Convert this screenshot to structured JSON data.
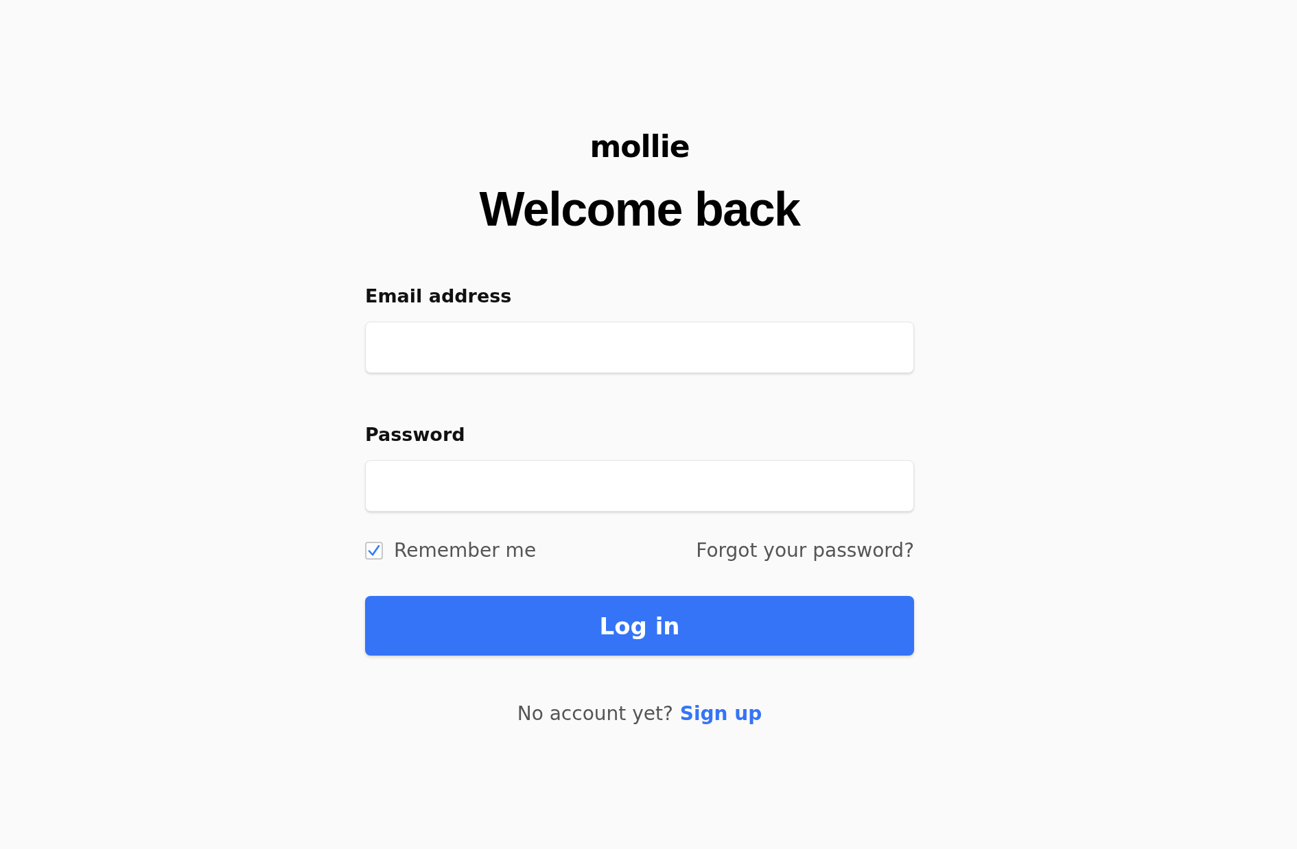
{
  "logo": "mollie",
  "title": "Welcome back",
  "fields": [
    {
      "label": "Email address"
    },
    {
      "label": "Password"
    }
  ],
  "remember": {
    "label": "Remember me",
    "checked": true
  },
  "forgot_link": "Forgot your password?",
  "login_button": "Log in",
  "signup": {
    "text": "No account yet?",
    "link": "Sign up"
  }
}
